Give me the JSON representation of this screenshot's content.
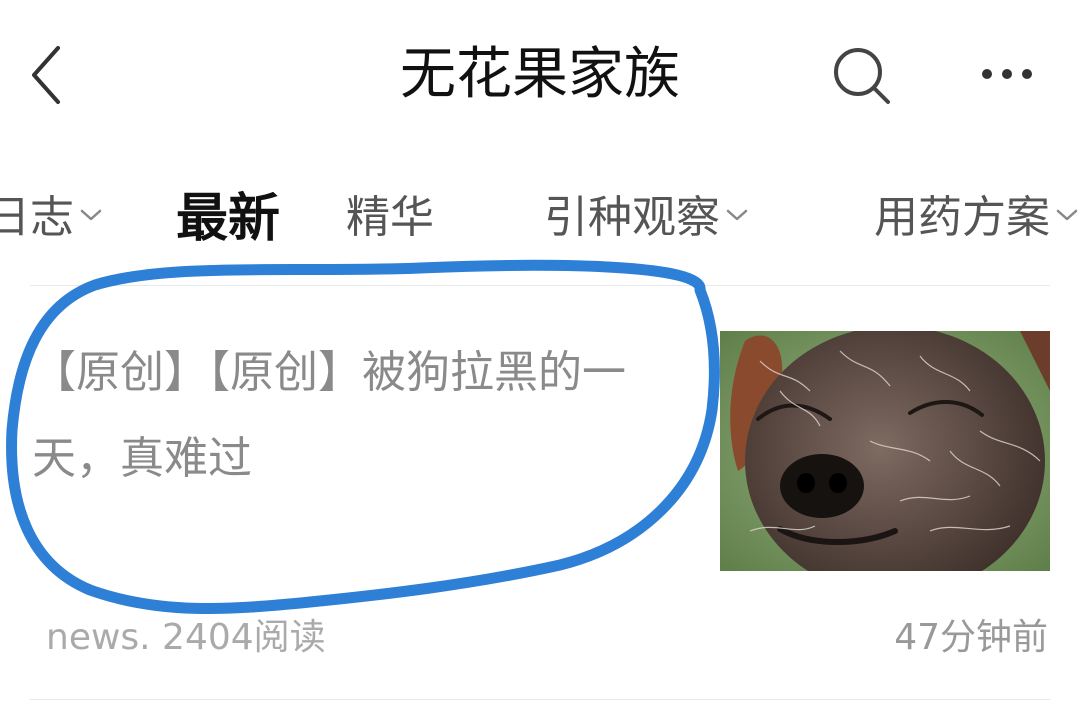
{
  "header": {
    "title": "无花果家族",
    "back_icon": "chevron-left-icon",
    "search_icon": "search-icon",
    "more_icon": "more-horizontal-icon"
  },
  "tabs": [
    {
      "label": "日志",
      "has_dropdown": true,
      "active": false
    },
    {
      "label": "最新",
      "has_dropdown": false,
      "active": true
    },
    {
      "label": "精华",
      "has_dropdown": false,
      "active": false
    },
    {
      "label": "引种观察",
      "has_dropdown": true,
      "active": false
    },
    {
      "label": "用药方案",
      "has_dropdown": true,
      "active": false
    }
  ],
  "post": {
    "title": "【原创】【原创】被狗拉黑的一天，真难过",
    "meta_left": "news. 2404阅读",
    "meta_right": "47分钟前"
  },
  "annotation": {
    "color": "#2e7fd6"
  }
}
